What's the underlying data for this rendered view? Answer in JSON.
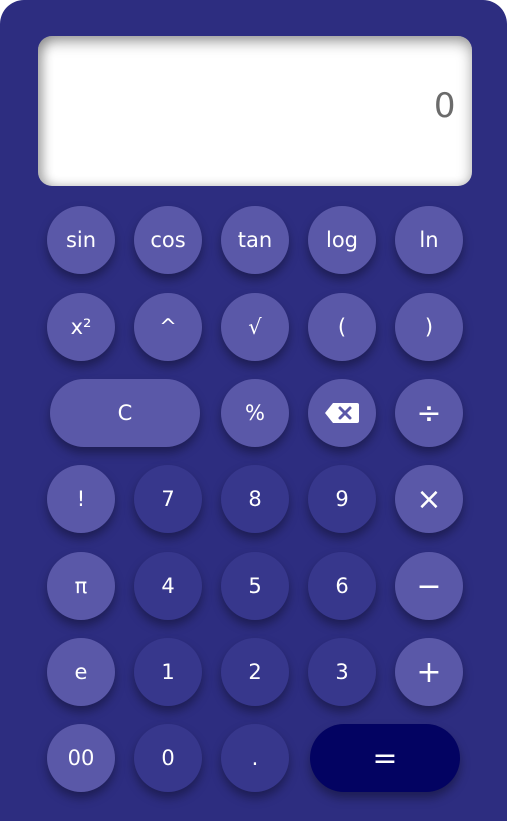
{
  "display": {
    "value": "0"
  },
  "keys": {
    "sin": "sin",
    "cos": "cos",
    "tan": "tan",
    "log": "log",
    "ln": "ln",
    "square": "x²",
    "power": "^",
    "sqrt": "√",
    "lparen": "(",
    "rparen": ")",
    "clear": "C",
    "percent": "%",
    "divide": "÷",
    "factorial": "!",
    "seven": "7",
    "eight": "8",
    "nine": "9",
    "multiply": "×",
    "pi": "π",
    "four": "4",
    "five": "5",
    "six": "6",
    "minus": "−",
    "e": "e",
    "one": "1",
    "two": "2",
    "three": "3",
    "plus": "+",
    "double_zero": "00",
    "zero": "0",
    "dot": ".",
    "equals": "="
  },
  "icons": {
    "backspace": "backspace-icon"
  },
  "colors": {
    "body": "#2d2d80",
    "function_key": "#5a58a8",
    "digit_key": "#37378c",
    "equals_key": "#030362",
    "display": "#ffffff",
    "display_text": "#6b6b6b"
  }
}
